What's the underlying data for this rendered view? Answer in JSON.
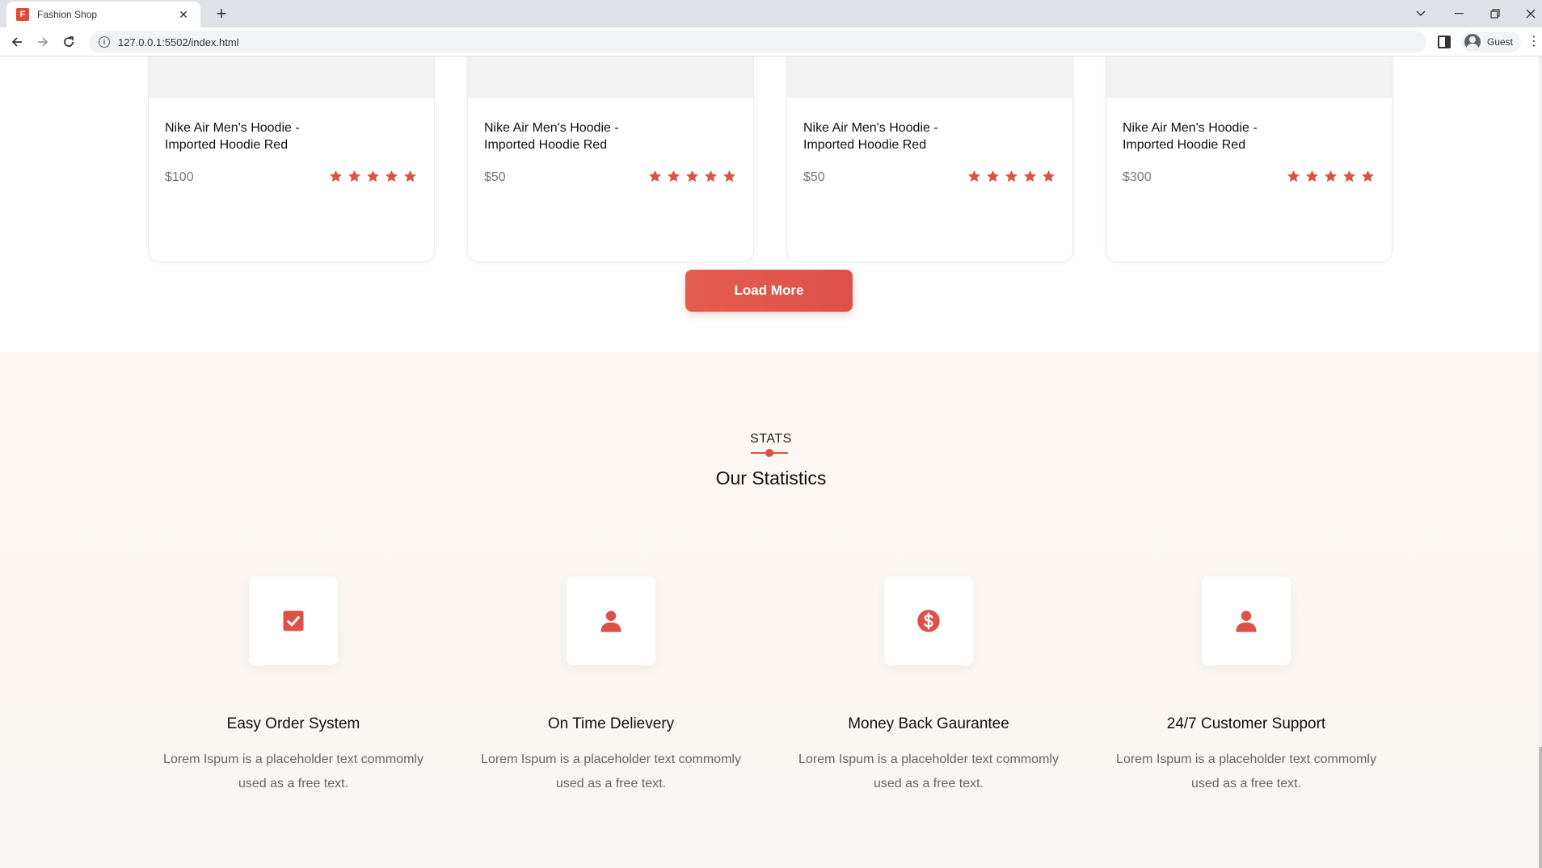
{
  "browser": {
    "tab_title": "Fashion Shop",
    "favicon_letter": "F",
    "tab_close": "✕",
    "new_tab": "+",
    "url": "127.0.0.1:5502/index.html",
    "profile_label": "Guest",
    "icons": [
      "back-icon",
      "forward-icon",
      "reload-icon",
      "info-icon",
      "side-panel-icon",
      "profile-icon",
      "menu-icon"
    ]
  },
  "products": [
    {
      "name": "Nike Air Men's Hoodie - Imported Hoodie Red",
      "price": "$100",
      "rating": 5
    },
    {
      "name": "Nike Air Men's Hoodie - Imported Hoodie Red",
      "price": "$50",
      "rating": 5
    },
    {
      "name": "Nike Air Men's Hoodie - Imported Hoodie Red",
      "price": "$50",
      "rating": 5
    },
    {
      "name": "Nike Air Men's Hoodie - Imported Hoodie Red",
      "price": "$300",
      "rating": 5
    }
  ],
  "load_more_label": "Load More",
  "stats": {
    "label": "STATS",
    "title": "Our Statistics",
    "features": [
      {
        "icon": "check-square-icon",
        "title": "Easy Order System",
        "description": "Lorem Ispum is a placeholder text commomly used as a free text."
      },
      {
        "icon": "user-icon",
        "title": "On Time Delievery",
        "description": "Lorem Ispum is a placeholder text commomly used as a free text."
      },
      {
        "icon": "dollar-circle-icon",
        "title": "Money Back Gaurantee",
        "description": "Lorem Ispum is a placeholder text commomly used as a free text."
      },
      {
        "icon": "user-icon",
        "title": "24/7 Customer Support",
        "description": "Lorem Ispum is a placeholder text commomly used as a free text."
      }
    ]
  },
  "colors": {
    "accent": "#dd5148",
    "stats_bg": "#fcf7f1"
  }
}
